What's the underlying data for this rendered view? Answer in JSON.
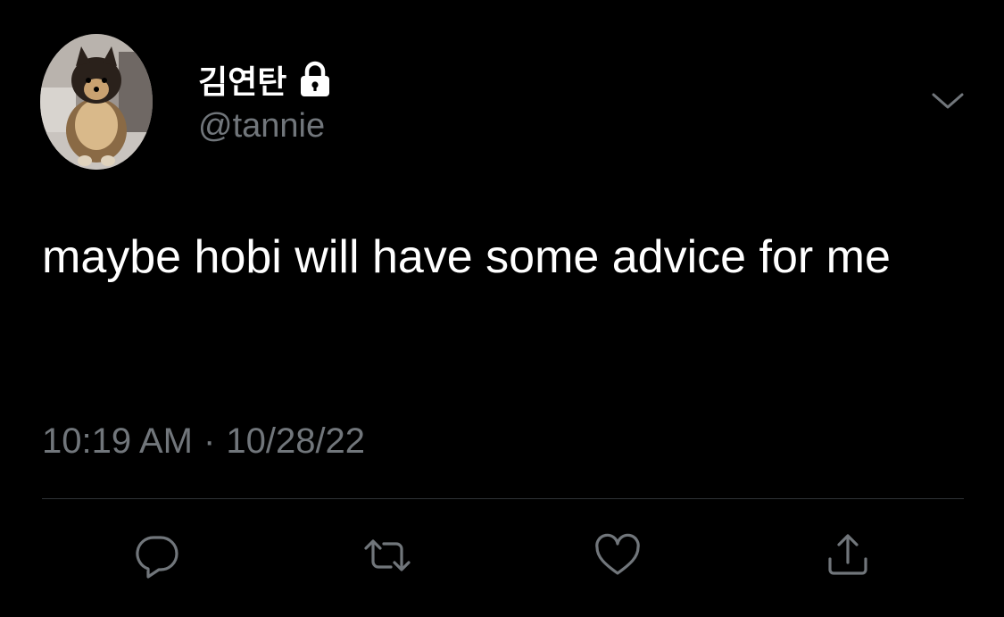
{
  "tweet": {
    "display_name": "김연탄",
    "handle": "@tannie",
    "text": "maybe hobi will have some advice for me",
    "time": "10:19 AM",
    "separator": "·",
    "date": "10/28/22"
  },
  "icons": {
    "lock": "lock-icon",
    "menu": "chevron-down-icon",
    "reply": "reply-icon",
    "retweet": "retweet-icon",
    "like": "heart-icon",
    "share": "share-icon"
  },
  "colors": {
    "background": "#000000",
    "primary_text": "#ffffff",
    "secondary_text": "#71767b",
    "divider": "#2f3336"
  }
}
